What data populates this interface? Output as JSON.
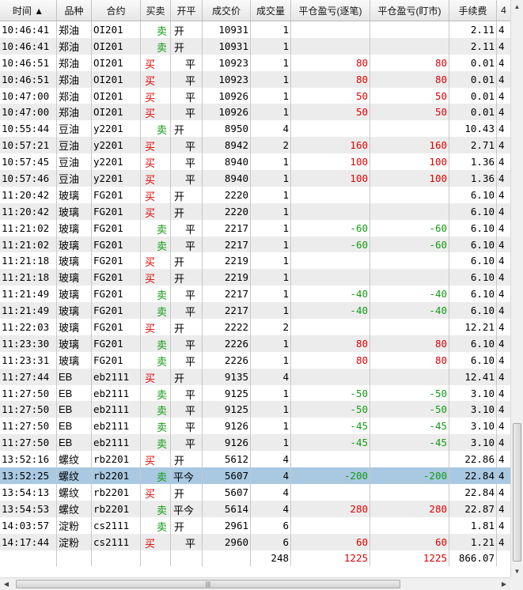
{
  "columns": [
    "时间 ▲",
    "品种",
    "合约",
    "买卖",
    "开平",
    "成交价",
    "成交量",
    "平仓盈亏(逐笔)",
    "平仓盈亏(盯市)",
    "手续费",
    "4"
  ],
  "rows": [
    {
      "time": "10:46:41",
      "product": "郑油",
      "contract": "OI201",
      "side": "卖",
      "oc": "开",
      "price": "10931",
      "qty": "1",
      "pnl1": "",
      "pnl2": "",
      "fee": "2.11",
      "extra": "4"
    },
    {
      "time": "10:46:41",
      "product": "郑油",
      "contract": "OI201",
      "side": "卖",
      "oc": "开",
      "price": "10931",
      "qty": "1",
      "pnl1": "",
      "pnl2": "",
      "fee": "2.11",
      "extra": "4"
    },
    {
      "time": "10:46:51",
      "product": "郑油",
      "contract": "OI201",
      "side": "买",
      "oc": "平",
      "price": "10923",
      "qty": "1",
      "pnl1": "80",
      "pnl2": "80",
      "fee": "0.01",
      "extra": "4"
    },
    {
      "time": "10:46:51",
      "product": "郑油",
      "contract": "OI201",
      "side": "买",
      "oc": "平",
      "price": "10923",
      "qty": "1",
      "pnl1": "80",
      "pnl2": "80",
      "fee": "0.01",
      "extra": "4"
    },
    {
      "time": "10:47:00",
      "product": "郑油",
      "contract": "OI201",
      "side": "买",
      "oc": "平",
      "price": "10926",
      "qty": "1",
      "pnl1": "50",
      "pnl2": "50",
      "fee": "0.01",
      "extra": "4"
    },
    {
      "time": "10:47:00",
      "product": "郑油",
      "contract": "OI201",
      "side": "买",
      "oc": "平",
      "price": "10926",
      "qty": "1",
      "pnl1": "50",
      "pnl2": "50",
      "fee": "0.01",
      "extra": "4"
    },
    {
      "time": "10:55:44",
      "product": "豆油",
      "contract": "y2201",
      "side": "卖",
      "oc": "开",
      "price": "8950",
      "qty": "4",
      "pnl1": "",
      "pnl2": "",
      "fee": "10.43",
      "extra": "4"
    },
    {
      "time": "10:57:21",
      "product": "豆油",
      "contract": "y2201",
      "side": "买",
      "oc": "平",
      "price": "8942",
      "qty": "2",
      "pnl1": "160",
      "pnl2": "160",
      "fee": "2.71",
      "extra": "4"
    },
    {
      "time": "10:57:45",
      "product": "豆油",
      "contract": "y2201",
      "side": "买",
      "oc": "平",
      "price": "8940",
      "qty": "1",
      "pnl1": "100",
      "pnl2": "100",
      "fee": "1.36",
      "extra": "4"
    },
    {
      "time": "10:57:46",
      "product": "豆油",
      "contract": "y2201",
      "side": "买",
      "oc": "平",
      "price": "8940",
      "qty": "1",
      "pnl1": "100",
      "pnl2": "100",
      "fee": "1.36",
      "extra": "4"
    },
    {
      "time": "11:20:42",
      "product": "玻璃",
      "contract": "FG201",
      "side": "买",
      "oc": "开",
      "price": "2220",
      "qty": "1",
      "pnl1": "",
      "pnl2": "",
      "fee": "6.10",
      "extra": "4"
    },
    {
      "time": "11:20:42",
      "product": "玻璃",
      "contract": "FG201",
      "side": "买",
      "oc": "开",
      "price": "2220",
      "qty": "1",
      "pnl1": "",
      "pnl2": "",
      "fee": "6.10",
      "extra": "4"
    },
    {
      "time": "11:21:02",
      "product": "玻璃",
      "contract": "FG201",
      "side": "卖",
      "oc": "平",
      "price": "2217",
      "qty": "1",
      "pnl1": "-60",
      "pnl2": "-60",
      "fee": "6.10",
      "extra": "4"
    },
    {
      "time": "11:21:02",
      "product": "玻璃",
      "contract": "FG201",
      "side": "卖",
      "oc": "平",
      "price": "2217",
      "qty": "1",
      "pnl1": "-60",
      "pnl2": "-60",
      "fee": "6.10",
      "extra": "4"
    },
    {
      "time": "11:21:18",
      "product": "玻璃",
      "contract": "FG201",
      "side": "买",
      "oc": "开",
      "price": "2219",
      "qty": "1",
      "pnl1": "",
      "pnl2": "",
      "fee": "6.10",
      "extra": "4"
    },
    {
      "time": "11:21:18",
      "product": "玻璃",
      "contract": "FG201",
      "side": "买",
      "oc": "开",
      "price": "2219",
      "qty": "1",
      "pnl1": "",
      "pnl2": "",
      "fee": "6.10",
      "extra": "4"
    },
    {
      "time": "11:21:49",
      "product": "玻璃",
      "contract": "FG201",
      "side": "卖",
      "oc": "平",
      "price": "2217",
      "qty": "1",
      "pnl1": "-40",
      "pnl2": "-40",
      "fee": "6.10",
      "extra": "4"
    },
    {
      "time": "11:21:49",
      "product": "玻璃",
      "contract": "FG201",
      "side": "卖",
      "oc": "平",
      "price": "2217",
      "qty": "1",
      "pnl1": "-40",
      "pnl2": "-40",
      "fee": "6.10",
      "extra": "4"
    },
    {
      "time": "11:22:03",
      "product": "玻璃",
      "contract": "FG201",
      "side": "买",
      "oc": "开",
      "price": "2222",
      "qty": "2",
      "pnl1": "",
      "pnl2": "",
      "fee": "12.21",
      "extra": "4"
    },
    {
      "time": "11:23:30",
      "product": "玻璃",
      "contract": "FG201",
      "side": "卖",
      "oc": "平",
      "price": "2226",
      "qty": "1",
      "pnl1": "80",
      "pnl2": "80",
      "fee": "6.10",
      "extra": "4"
    },
    {
      "time": "11:23:31",
      "product": "玻璃",
      "contract": "FG201",
      "side": "卖",
      "oc": "平",
      "price": "2226",
      "qty": "1",
      "pnl1": "80",
      "pnl2": "80",
      "fee": "6.10",
      "extra": "4"
    },
    {
      "time": "11:27:44",
      "product": "EB",
      "contract": "eb2111",
      "side": "买",
      "oc": "开",
      "price": "9135",
      "qty": "4",
      "pnl1": "",
      "pnl2": "",
      "fee": "12.41",
      "extra": "4"
    },
    {
      "time": "11:27:50",
      "product": "EB",
      "contract": "eb2111",
      "side": "卖",
      "oc": "平",
      "price": "9125",
      "qty": "1",
      "pnl1": "-50",
      "pnl2": "-50",
      "fee": "3.10",
      "extra": "4"
    },
    {
      "time": "11:27:50",
      "product": "EB",
      "contract": "eb2111",
      "side": "卖",
      "oc": "平",
      "price": "9125",
      "qty": "1",
      "pnl1": "-50",
      "pnl2": "-50",
      "fee": "3.10",
      "extra": "4"
    },
    {
      "time": "11:27:50",
      "product": "EB",
      "contract": "eb2111",
      "side": "卖",
      "oc": "平",
      "price": "9126",
      "qty": "1",
      "pnl1": "-45",
      "pnl2": "-45",
      "fee": "3.10",
      "extra": "4"
    },
    {
      "time": "11:27:50",
      "product": "EB",
      "contract": "eb2111",
      "side": "卖",
      "oc": "平",
      "price": "9126",
      "qty": "1",
      "pnl1": "-45",
      "pnl2": "-45",
      "fee": "3.10",
      "extra": "4"
    },
    {
      "time": "13:52:16",
      "product": "螺纹",
      "contract": "rb2201",
      "side": "买",
      "oc": "开",
      "price": "5612",
      "qty": "4",
      "pnl1": "",
      "pnl2": "",
      "fee": "22.86",
      "extra": "4"
    },
    {
      "time": "13:52:25",
      "product": "螺纹",
      "contract": "rb2201",
      "side": "卖",
      "oc": "平今",
      "price": "5607",
      "qty": "4",
      "pnl1": "-200",
      "pnl2": "-200",
      "fee": "22.84",
      "extra": "4",
      "selected": true
    },
    {
      "time": "13:54:13",
      "product": "螺纹",
      "contract": "rb2201",
      "side": "买",
      "oc": "开",
      "price": "5607",
      "qty": "4",
      "pnl1": "",
      "pnl2": "",
      "fee": "22.84",
      "extra": "4"
    },
    {
      "time": "13:54:53",
      "product": "螺纹",
      "contract": "rb2201",
      "side": "卖",
      "oc": "平今",
      "price": "5614",
      "qty": "4",
      "pnl1": "280",
      "pnl2": "280",
      "fee": "22.87",
      "extra": "4"
    },
    {
      "time": "14:03:57",
      "product": "淀粉",
      "contract": "cs2111",
      "side": "卖",
      "oc": "开",
      "price": "2961",
      "qty": "6",
      "pnl1": "",
      "pnl2": "",
      "fee": "1.81",
      "extra": "4"
    },
    {
      "time": "14:17:44",
      "product": "淀粉",
      "contract": "cs2111",
      "side": "买",
      "oc": "平",
      "price": "2960",
      "qty": "6",
      "pnl1": "60",
      "pnl2": "60",
      "fee": "1.21",
      "extra": "4"
    }
  ],
  "totals": {
    "qty": "248",
    "pnl1": "1225",
    "pnl2": "1225",
    "fee": "866.07"
  },
  "colors": {
    "buy": "#e00000",
    "sell": "#139b13",
    "selected_row": "#a9c9e2",
    "alt_row": "#ececec"
  },
  "icons": {
    "scroll_up": "▲",
    "scroll_down": "▼",
    "scroll_left": "◀",
    "scroll_right": "▶",
    "grip": "|||"
  }
}
